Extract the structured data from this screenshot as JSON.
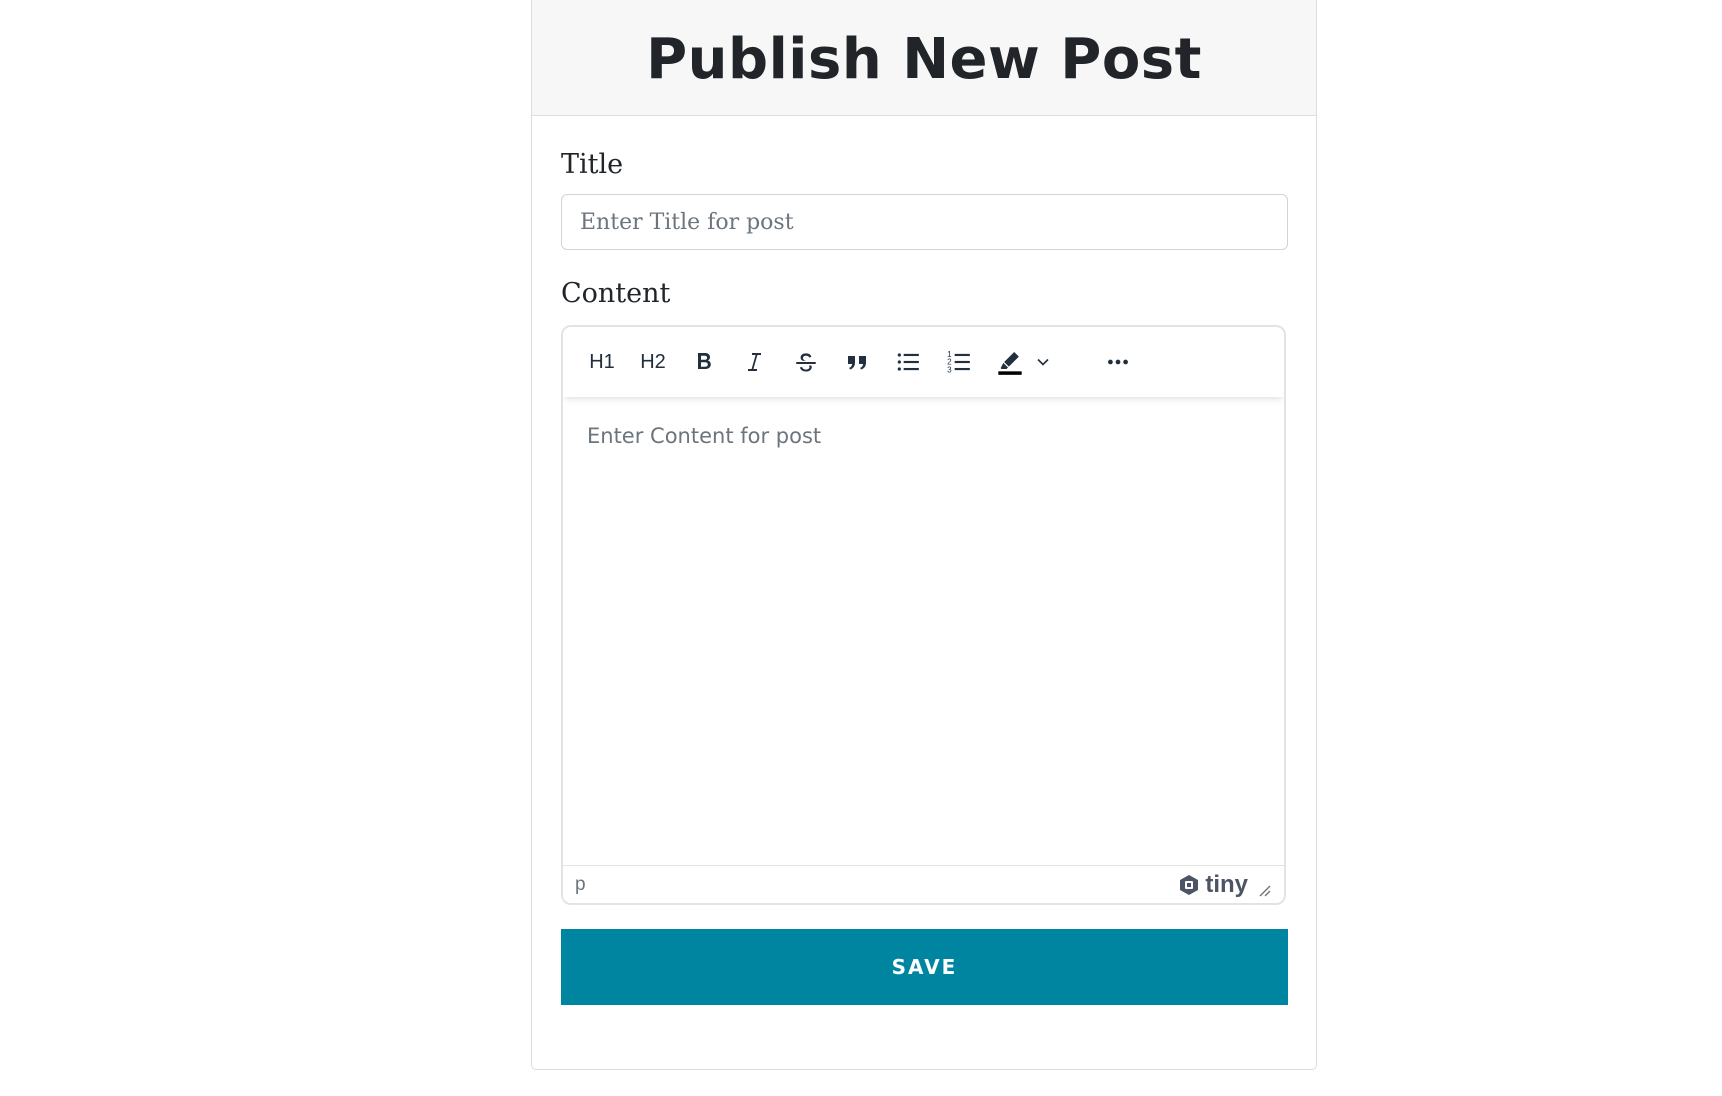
{
  "header": {
    "title": "Publish New Post"
  },
  "form": {
    "title_label": "Title",
    "title_placeholder": "Enter Title for post",
    "content_label": "Content",
    "content_placeholder": "Enter Content for post",
    "save_label": "SAVE"
  },
  "editor": {
    "toolbar": [
      {
        "name": "heading-1",
        "label": "H1"
      },
      {
        "name": "heading-2",
        "label": "H2"
      },
      {
        "name": "bold",
        "icon": "bold-icon"
      },
      {
        "name": "italic",
        "icon": "italic-icon"
      },
      {
        "name": "strikethrough",
        "icon": "strikethrough-icon"
      },
      {
        "name": "blockquote",
        "icon": "quote-icon"
      },
      {
        "name": "bullet-list",
        "icon": "bullet-list-icon"
      },
      {
        "name": "numbered-list",
        "icon": "numbered-list-icon"
      },
      {
        "name": "highlight-color",
        "icon": "highlighter-icon"
      },
      {
        "name": "more",
        "icon": "more-horizontal-icon"
      }
    ],
    "status_path": "p",
    "brand": "tiny"
  },
  "colors": {
    "primary": "#0085a1",
    "header_bg": "#f7f7f7",
    "icon": "#222f3e"
  }
}
